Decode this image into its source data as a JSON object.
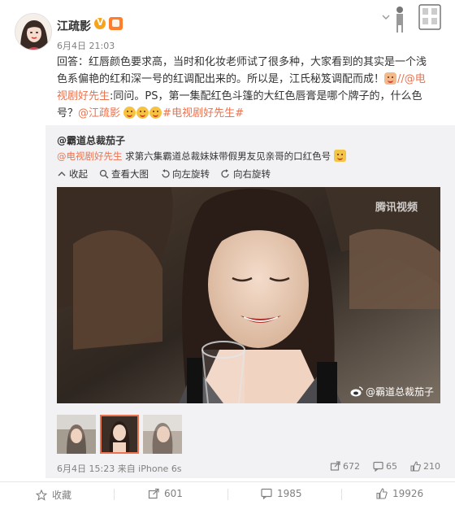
{
  "post": {
    "username": "江疏影",
    "time": "6月4日 21:03",
    "text": {
      "line1": "回答：红唇颜色要求高，当时和化妆老师试了很多种，大家看到的其实是一个浅",
      "line2a": "色系偏艳的红和深一号的红调配出来的。所以是，江氏秘笈调配而成！",
      "line2b": "//@电",
      "line3a": "视剧好先生",
      "line3b": ":同问。PS，第一集配红色斗篷的大红色唇膏是哪个牌子的，什么色",
      "line4a": "号？",
      "line4b": "@江疏影",
      "line4c": "#电视剧好先生#"
    }
  },
  "repost": {
    "author": "@霸道总裁茄子",
    "mention": "@电视剧好先生",
    "text": " 求第六集霸道总裁妹妹带假男友见亲哥的口红色号",
    "tools": {
      "collapse": "收起",
      "view_large": "查看大图",
      "rotate_left": "向左旋转",
      "rotate_right": "向右旋转"
    },
    "photo": {
      "logo": "腾讯视频",
      "watermark": "@霸道总裁茄子"
    },
    "meta": "6月4日 15:23 来自 iPhone 6s",
    "stats": {
      "reposts": "672",
      "comments": "65",
      "likes": "210"
    }
  },
  "actions": {
    "favorite": "收藏",
    "repost": "601",
    "comment": "1985",
    "like": "19926"
  },
  "colors": {
    "link": "#eb7350",
    "repost_bg": "#f2f2f5",
    "muted": "#808080"
  }
}
